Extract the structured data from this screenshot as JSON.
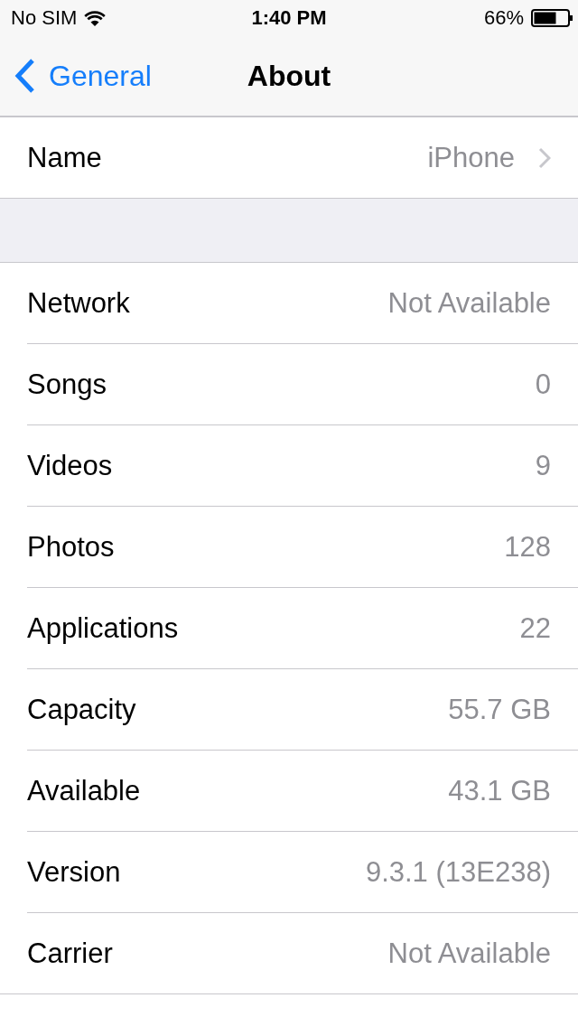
{
  "status_bar": {
    "carrier": "No SIM",
    "time": "1:40 PM",
    "battery": "66%"
  },
  "nav_bar": {
    "back": "General",
    "title": "About"
  },
  "sections": [
    {
      "rows": [
        {
          "label": "Name",
          "value": "iPhone",
          "disclosure": true
        }
      ]
    },
    {
      "rows": [
        {
          "label": "Network",
          "value": "Not Available",
          "disclosure": false
        },
        {
          "label": "Songs",
          "value": "0",
          "disclosure": false
        },
        {
          "label": "Videos",
          "value": "9",
          "disclosure": false
        },
        {
          "label": "Photos",
          "value": "128",
          "disclosure": false
        },
        {
          "label": "Applications",
          "value": "22",
          "disclosure": false
        },
        {
          "label": "Capacity",
          "value": "55.7 GB",
          "disclosure": false
        },
        {
          "label": "Available",
          "value": "43.1 GB",
          "disclosure": false
        },
        {
          "label": "Version",
          "value": "9.3.1 (13E238)",
          "disclosure": false
        },
        {
          "label": "Carrier",
          "value": "Not Available",
          "disclosure": false
        }
      ]
    }
  ]
}
